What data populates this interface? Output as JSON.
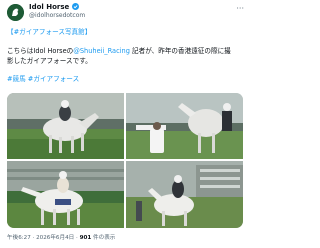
{
  "account": {
    "name": "Idol Horse",
    "verified": true,
    "handle": "@idolhorsedotcom"
  },
  "post": {
    "tag_line": "【#ガイアフォース写真館】",
    "body_prefix": "こちらはIdol Horseの",
    "mention": "@Shuheii_Racing",
    "body_suffix": " 記者が、昨年の香港遠征の際に撮",
    "body_line2": "影したガイアフォースです。",
    "hashtags": "#競馬 #ガイアフォース",
    "photos": [
      {
        "alt": "racehorse galloping on turf course"
      },
      {
        "alt": "racehorse at trackside with person"
      },
      {
        "alt": "racehorse in front of grandstand"
      },
      {
        "alt": "racehorse with rider near stands"
      }
    ]
  },
  "meta": {
    "time_date": "午後6:27 · 2026年6月4日 · ",
    "views_count": "901",
    "views_label": " 件の表示"
  },
  "colors": {
    "link": "#1d9bf0",
    "muted": "#536471",
    "text": "#0f1419"
  }
}
